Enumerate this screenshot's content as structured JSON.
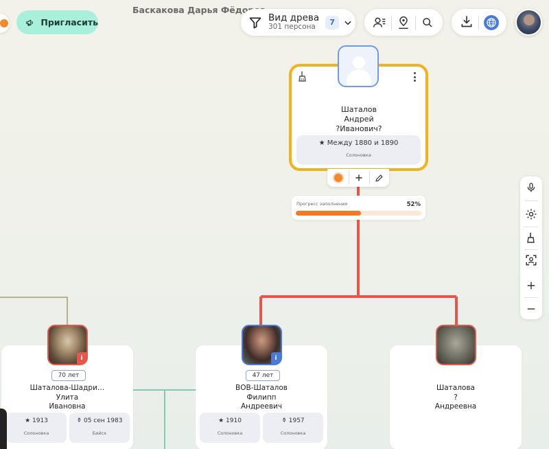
{
  "header": {
    "invite_label": "Пригласить",
    "page_title": "Баскакова Дарья Фёдоров",
    "view": {
      "label": "Вид древа",
      "count_text": "301 персона",
      "badge": "7"
    }
  },
  "focus_person": {
    "name_line1": "Шаталов",
    "name_line2": "Андрей",
    "name_line3": "?Иванович?",
    "date": "Между 1880 и 1890",
    "place": "Солоновка",
    "progress_label": "Прогресс заполнения",
    "progress_text": "52%",
    "progress_value": 0.52
  },
  "children": [
    {
      "age": "70 лет",
      "name_line1": "Шаталова-Шадри…",
      "name_line2": "Улита",
      "name_line3": "Ивановна",
      "birth": "1913",
      "birth_place": "Солоновка",
      "death": "05 сен 1983",
      "death_place": "Бийск",
      "gender": "female"
    },
    {
      "age": "47 лет",
      "name_line1": "ВОВ-Шаталов",
      "name_line2": "Филипп",
      "name_line3": "Андреевич",
      "birth": "1910",
      "birth_place": "Солоновка",
      "death": "1957",
      "death_place": "Солоновка",
      "gender": "male"
    },
    {
      "name_line1": "Шаталова",
      "name_line2": "?",
      "name_line3": "Андреевна",
      "gender": "female"
    }
  ],
  "colors": {
    "accent_yellow": "#f2b31a",
    "line_red": "#e4574a",
    "progress_orange": "#f07a25",
    "invite_green": "#a9f0db",
    "male_blue": "#4a7bdc",
    "female_red": "#e4574a"
  },
  "icons": [
    "filter-icon",
    "chevron-down-icon",
    "person-list-icon",
    "map-pin-person-icon",
    "search-icon",
    "download-icon",
    "globe-icon",
    "broom-icon",
    "more-vertical-icon",
    "plus-icon",
    "pencil-icon",
    "microphone-icon",
    "gear-icon",
    "face-scan-icon",
    "zoom-in-icon",
    "zoom-out-icon",
    "megaphone-icon"
  ]
}
